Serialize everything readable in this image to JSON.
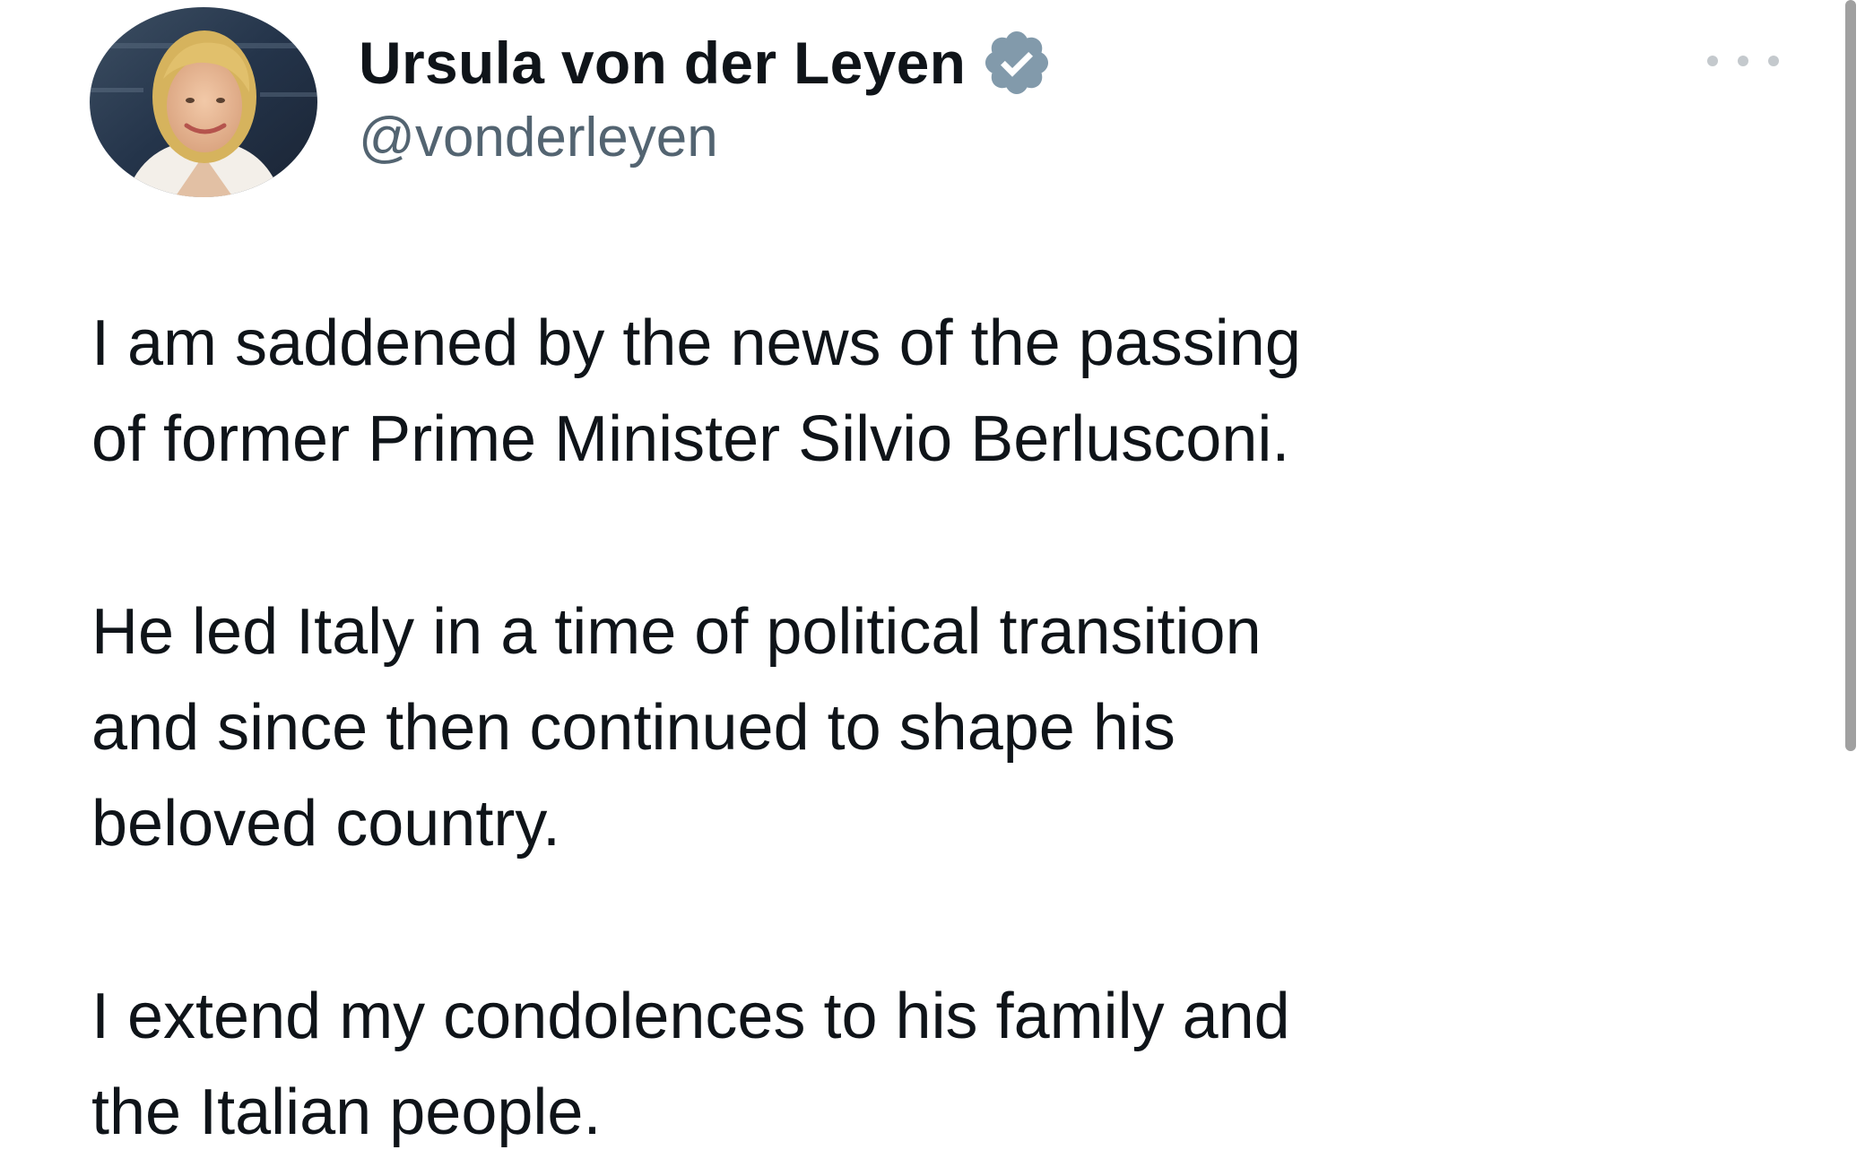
{
  "author": {
    "display_name": "Ursula von der Leyen",
    "handle": "@vonderleyen",
    "verified_icon": "verified-badge-icon"
  },
  "menu": {
    "icon": "more-options-icon"
  },
  "tweet": {
    "paragraphs": [
      {
        "line1": "I am saddened by the news of the passing",
        "line2": "of former Prime Minister Silvio Berlusconi."
      },
      {
        "line1": "He led Italy in a time of political transition",
        "line2": "and since then continued to shape his",
        "line3": "beloved country."
      },
      {
        "line1": "I extend my condolences to his family and",
        "line2": "the Italian people."
      }
    ]
  },
  "colors": {
    "text": "#0f1419",
    "handle": "#536471",
    "verified": "#829aab",
    "dots": "#c4c9cd"
  }
}
